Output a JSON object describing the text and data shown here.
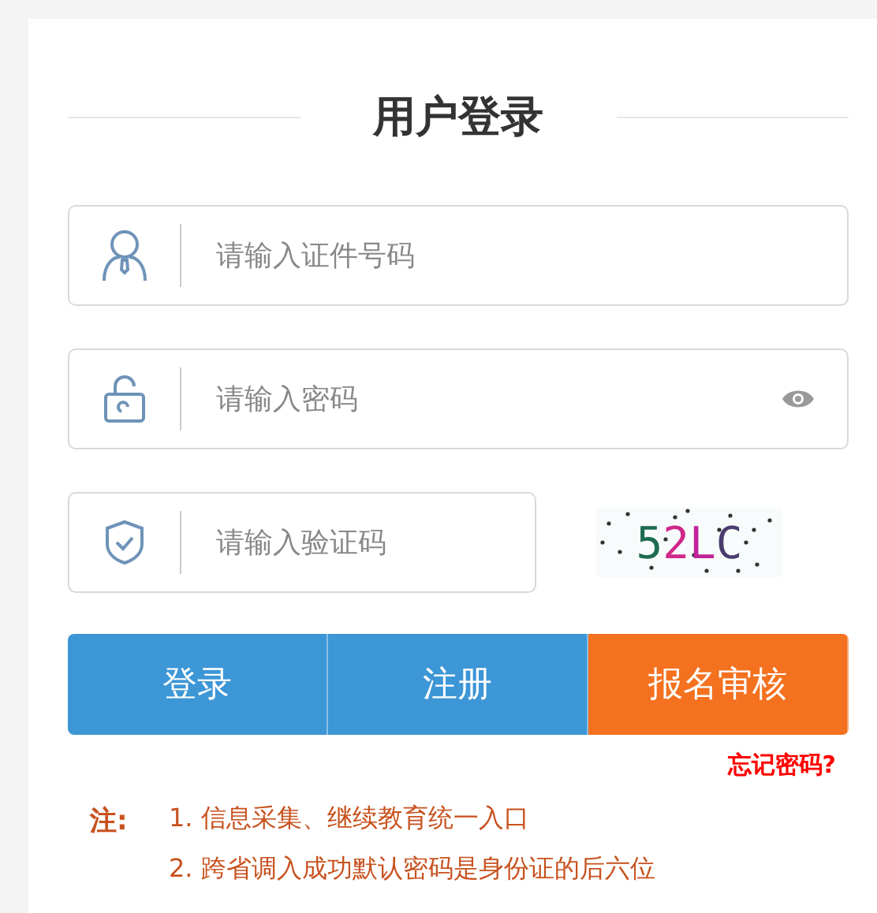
{
  "title": "用户登录",
  "fields": [
    {
      "kind": "id",
      "placeholder": "请输入证件号码"
    },
    {
      "kind": "password",
      "placeholder": "请输入密码"
    },
    {
      "kind": "captcha",
      "placeholder": "请输入验证码"
    }
  ],
  "captcha": "52LC",
  "buttons": [
    {
      "label": "登录",
      "color": "#3d96d6"
    },
    {
      "label": "注册",
      "color": "#3d96d6"
    },
    {
      "label": "报名审核",
      "color": "#f4711f"
    }
  ],
  "forgot_link": "忘记密码?",
  "notes": {
    "label": "注:",
    "items": [
      "1. 信息采集、继续教育统一入口",
      "2. 跨省调入成功默认密码是身份证的后六位"
    ]
  }
}
